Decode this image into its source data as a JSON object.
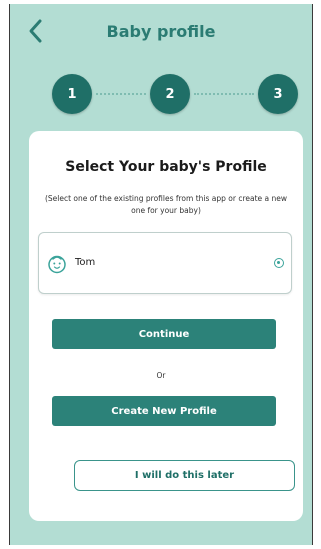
{
  "header": {
    "title": "Baby profile",
    "back_icon": "chevron-left-icon"
  },
  "stepper": {
    "steps": [
      "1",
      "2",
      "3"
    ]
  },
  "card": {
    "title": "Select Your baby's Profile",
    "subtitle": "(Select one of the existing profiles from this app or create a new one for your baby)",
    "profiles": [
      {
        "name": "Tom",
        "icon": "baby-face-icon",
        "selected": true
      }
    ],
    "continue_label": "Continue",
    "or_label": "Or",
    "create_label": "Create New Profile",
    "later_label": "I will do this later"
  },
  "colors": {
    "background": "#b3ddd3",
    "primary": "#2c8279",
    "step_circle": "#1f6f67",
    "title": "#2b7c73"
  }
}
